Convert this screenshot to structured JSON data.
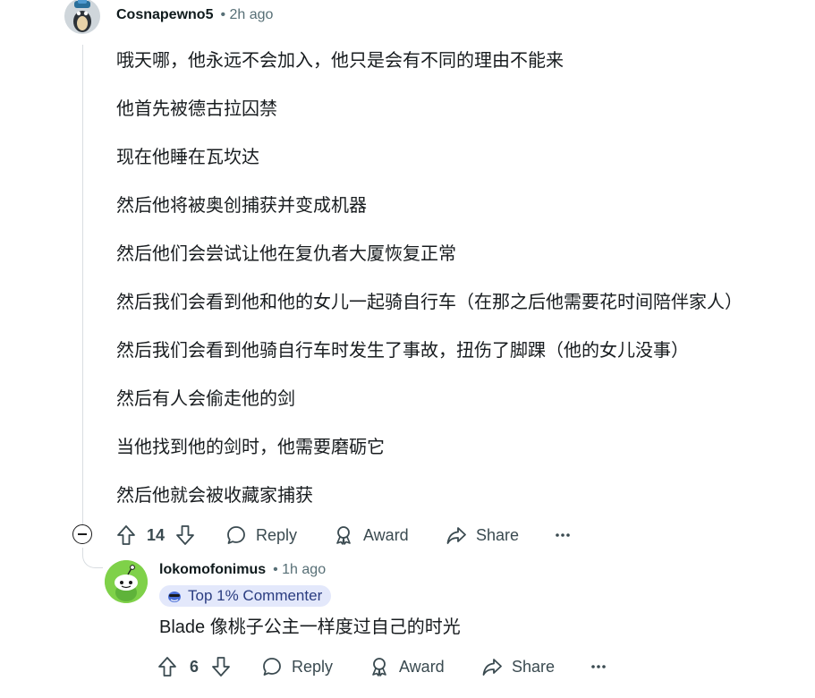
{
  "comment": {
    "author": "Cosnapewno5",
    "time": "• 2h ago",
    "paragraphs": [
      "哦天哪，他永远不会加入，他只是会有不同的理由不能来",
      "他首先被德古拉囚禁",
      "现在他睡在瓦坎达",
      "然后他将被奥创捕获并变成机器",
      "然后他们会尝试让他在复仇者大厦恢复正常",
      "然后我们会看到他和他的女儿一起骑自行车（在那之后他需要花时间陪伴家人）",
      "然后我们会看到他骑自行车时发生了事故，扭伤了脚踝（他的女儿没事）",
      "然后有人会偷走他的剑",
      "当他找到他的剑时，他需要磨砺它",
      "然后他就会被收藏家捕获"
    ],
    "votes": "14",
    "reply_label": "Reply",
    "award_label": "Award",
    "share_label": "Share"
  },
  "reply": {
    "author": "lokomofonimus",
    "time": "• 1h ago",
    "badge": "Top 1% Commenter",
    "text": "Blade 像桃子公主一样度过自己的时光",
    "votes": "6",
    "reply_label": "Reply",
    "award_label": "Award",
    "share_label": "Share"
  },
  "icons": {
    "upvote": "arrow-up-icon",
    "downvote": "arrow-down-icon",
    "reply": "speech-bubble-icon",
    "award": "award-ribbon-icon",
    "share": "share-arrow-icon",
    "more": "ellipsis-icon",
    "collapse": "minus-circle-icon",
    "badge": "commenter-icon"
  },
  "colors": {
    "text": "#181c1f",
    "meta": "#576f76",
    "badge_bg": "#e3e8fb",
    "snoo_bg": "#7fd149"
  }
}
